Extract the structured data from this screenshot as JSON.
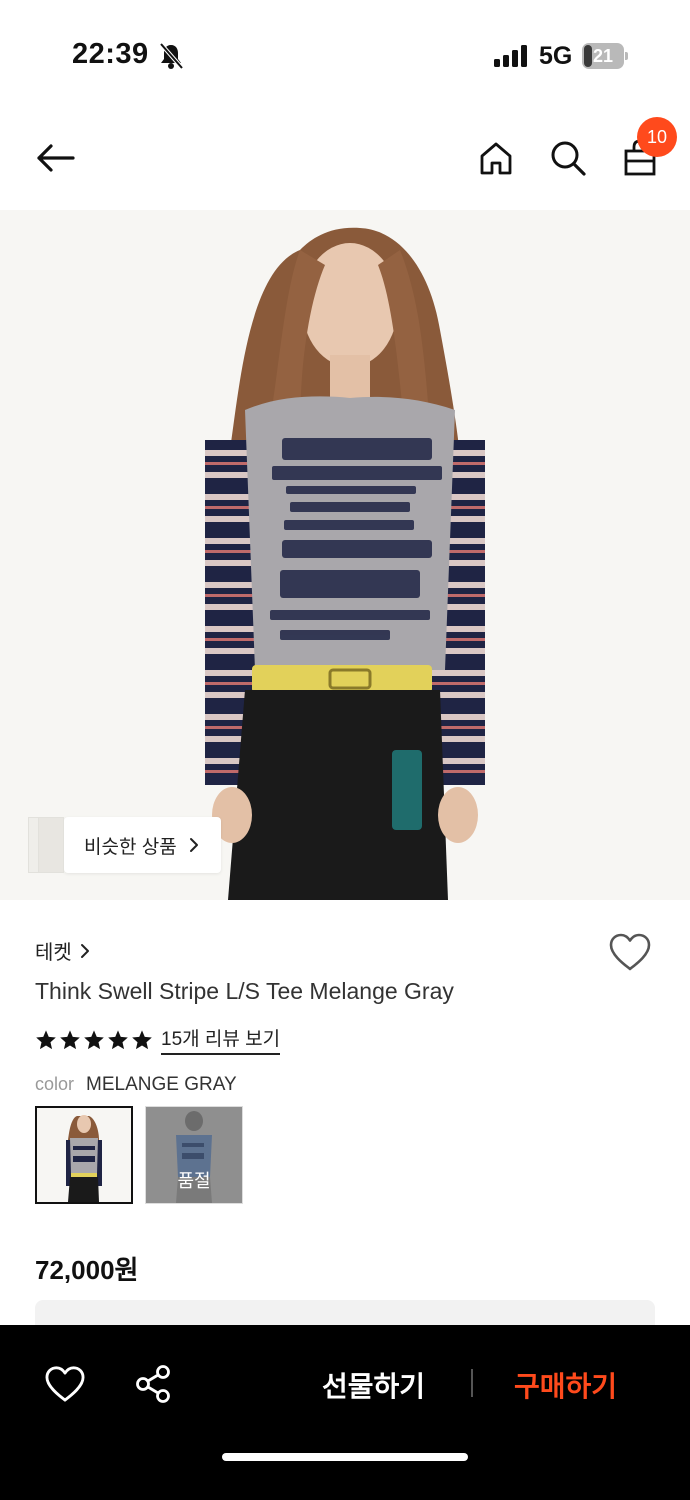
{
  "status_bar": {
    "time": "22:39",
    "network": "5G",
    "battery_level": "21",
    "battery_fraction": 0.21,
    "icons": [
      "bell-muted-icon",
      "signal-icon",
      "battery-icon"
    ]
  },
  "nav": {
    "icons": [
      "back-arrow-icon",
      "home-icon",
      "search-icon",
      "shopping-bag-icon"
    ],
    "cart_count": "10"
  },
  "product": {
    "image_alt": "Think Swell Stripe L/S Tee Melange Gray",
    "similar_label": "비슷한 상품",
    "brand": "테켓",
    "title": "Think Swell Stripe L/S Tee Melange Gray",
    "rating": 5,
    "review_link": "15개 리뷰 보기",
    "color_label": "color",
    "color_value": "MELANGE GRAY",
    "swatches": [
      {
        "name": "MELANGE GRAY",
        "selected": true,
        "sold_out": false
      },
      {
        "name": "BLUE",
        "selected": false,
        "sold_out": true,
        "status": "품절"
      }
    ],
    "price": "72,000원"
  },
  "bottom_bar": {
    "gift_label": "선물하기",
    "buy_label": "구매하기",
    "accent_color": "#ff4a1c"
  },
  "colors": {
    "accent": "#ff4a1c",
    "background": "#ffffff",
    "bottom_bar": "#000000"
  }
}
